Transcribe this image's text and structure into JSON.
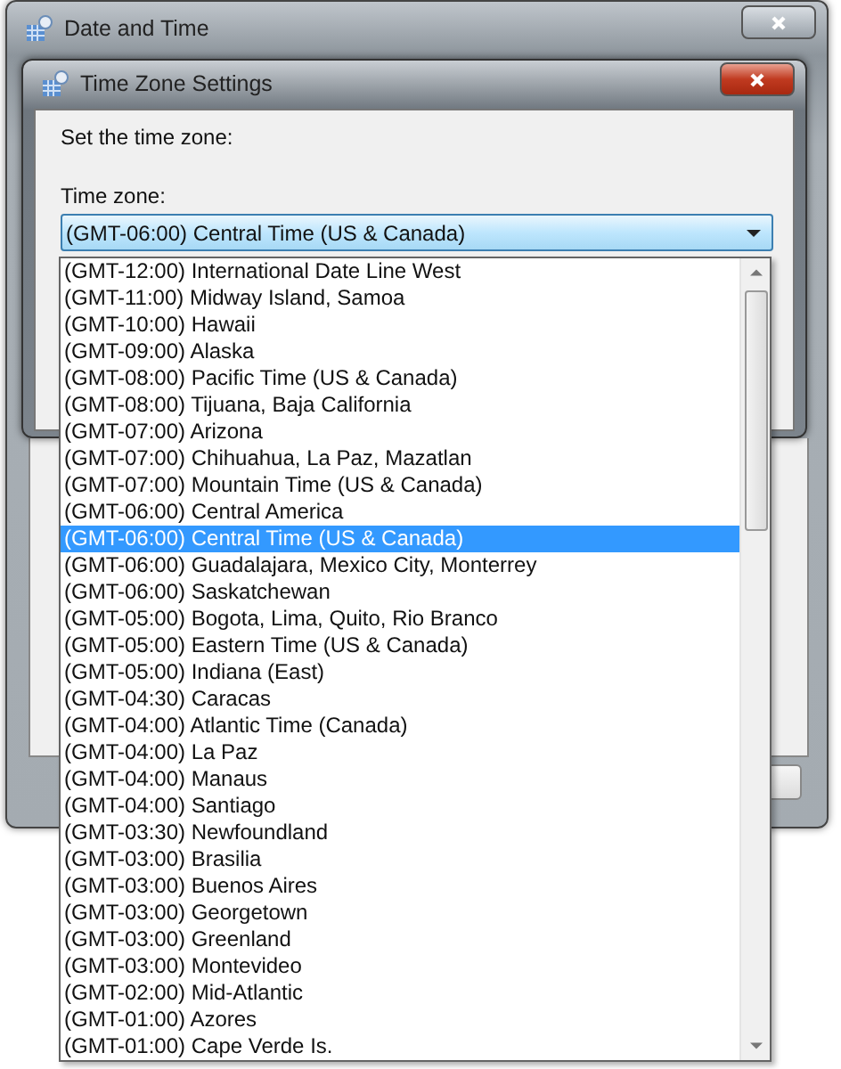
{
  "outer_window": {
    "title": "Date and Time"
  },
  "dialog": {
    "title": "Time Zone Settings",
    "instruction": "Set the time zone:",
    "time_zone_label": "Time zone:",
    "time_zone_value": "(GMT-06:00) Central Time (US & Canada)"
  },
  "time_zone_options": [
    {
      "label": "(GMT-12:00) International Date Line West",
      "selected": false
    },
    {
      "label": "(GMT-11:00) Midway Island, Samoa",
      "selected": false
    },
    {
      "label": "(GMT-10:00) Hawaii",
      "selected": false
    },
    {
      "label": "(GMT-09:00) Alaska",
      "selected": false
    },
    {
      "label": "(GMT-08:00) Pacific Time (US & Canada)",
      "selected": false
    },
    {
      "label": "(GMT-08:00) Tijuana, Baja California",
      "selected": false
    },
    {
      "label": "(GMT-07:00) Arizona",
      "selected": false
    },
    {
      "label": "(GMT-07:00) Chihuahua, La Paz, Mazatlan",
      "selected": false
    },
    {
      "label": "(GMT-07:00) Mountain Time (US & Canada)",
      "selected": false
    },
    {
      "label": "(GMT-06:00) Central America",
      "selected": false
    },
    {
      "label": "(GMT-06:00) Central Time (US & Canada)",
      "selected": true
    },
    {
      "label": "(GMT-06:00) Guadalajara, Mexico City, Monterrey",
      "selected": false
    },
    {
      "label": "(GMT-06:00) Saskatchewan",
      "selected": false
    },
    {
      "label": "(GMT-05:00) Bogota, Lima, Quito, Rio Branco",
      "selected": false
    },
    {
      "label": "(GMT-05:00) Eastern Time (US & Canada)",
      "selected": false
    },
    {
      "label": "(GMT-05:00) Indiana (East)",
      "selected": false
    },
    {
      "label": "(GMT-04:30) Caracas",
      "selected": false
    },
    {
      "label": "(GMT-04:00) Atlantic Time (Canada)",
      "selected": false
    },
    {
      "label": "(GMT-04:00) La Paz",
      "selected": false
    },
    {
      "label": "(GMT-04:00) Manaus",
      "selected": false
    },
    {
      "label": "(GMT-04:00) Santiago",
      "selected": false
    },
    {
      "label": "(GMT-03:30) Newfoundland",
      "selected": false
    },
    {
      "label": "(GMT-03:00) Brasilia",
      "selected": false
    },
    {
      "label": "(GMT-03:00) Buenos Aires",
      "selected": false
    },
    {
      "label": "(GMT-03:00) Georgetown",
      "selected": false
    },
    {
      "label": "(GMT-03:00) Greenland",
      "selected": false
    },
    {
      "label": "(GMT-03:00) Montevideo",
      "selected": false
    },
    {
      "label": "(GMT-02:00) Mid-Atlantic",
      "selected": false
    },
    {
      "label": "(GMT-01:00) Azores",
      "selected": false
    },
    {
      "label": "(GMT-01:00) Cape Verde Is.",
      "selected": false
    }
  ]
}
